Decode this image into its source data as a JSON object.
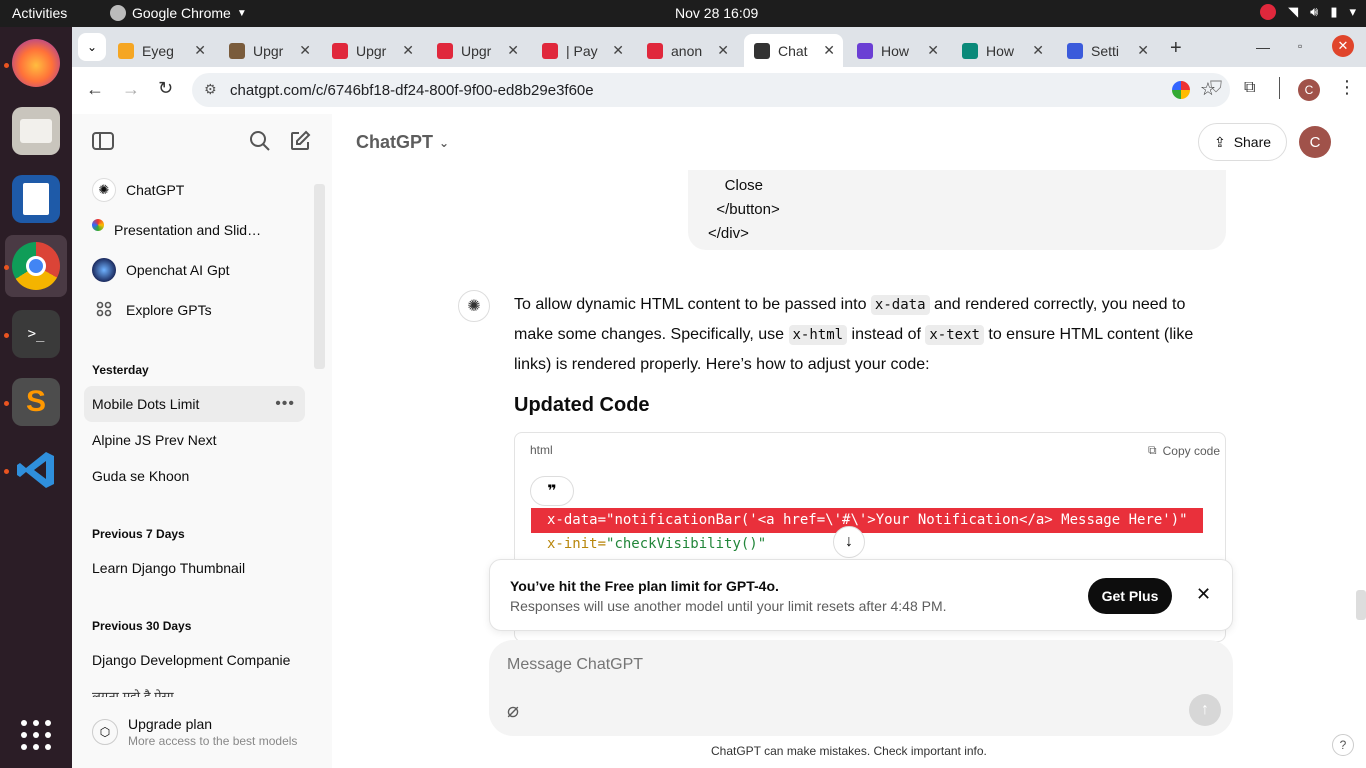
{
  "desktop": {
    "activities": "Activities",
    "app_name": "Google Chrome",
    "clock": "Nov 28  16:09"
  },
  "browser": {
    "tabs": [
      {
        "label": "Eyeg",
        "color": "#f5a623"
      },
      {
        "label": "Upgr",
        "color": "#7a5c3c"
      },
      {
        "label": "Upgr",
        "color": "#e0283c"
      },
      {
        "label": "Upgr",
        "color": "#e0283c"
      },
      {
        "label": "| Pay",
        "color": "#e0283c"
      },
      {
        "label": "anon",
        "color": "#e0283c"
      },
      {
        "label": "Chat",
        "color": "#333333"
      },
      {
        "label": "How",
        "color": "#6b3fd4"
      },
      {
        "label": "How",
        "color": "#0b8a7a"
      },
      {
        "label": "Setti",
        "color": "#3b5bdb"
      }
    ],
    "url": "chatgpt.com/c/6746bf18-df24-800f-9f00-ed8b29e3f60e",
    "profile_initial": "C"
  },
  "sidebar": {
    "pinned": [
      {
        "label": "ChatGPT"
      },
      {
        "label": "Presentation and Slid…"
      },
      {
        "label": "Openchat AI Gpt"
      },
      {
        "label": "Explore GPTs"
      }
    ],
    "sections": [
      {
        "title": "Yesterday",
        "items": [
          "Mobile Dots Limit",
          "Alpine JS Prev Next",
          "Guda se Khoon"
        ]
      },
      {
        "title": "Previous 7 Days",
        "items": [
          "Learn Django Thumbnail"
        ]
      },
      {
        "title": "Previous 30 Days",
        "items": [
          "Django Development Companie",
          "लगता मुझे है ऐसा"
        ]
      }
    ],
    "upgrade": {
      "title": "Upgrade plan",
      "subtitle": "More access to the best models"
    }
  },
  "header": {
    "model": "ChatGPT",
    "share": "Share",
    "avatar": "C"
  },
  "user_message": {
    "lines": [
      "    Close",
      "  </button>",
      "</div>"
    ]
  },
  "assistant": {
    "intro_1": "To allow dynamic HTML content to be passed into ",
    "code_1": "x-data",
    "intro_2": " and rendered correctly, you need to make some changes. Specifically, use ",
    "code_2": "x-html",
    "intro_3": " instead of ",
    "code_3": "x-text",
    "intro_4": " to ensure HTML content (like links) is rendered properly. Here’s how to adjust your code:",
    "heading": "Updated Code",
    "code_lang": "html",
    "copy_label": "Copy code",
    "code_line_1_attr": "x-data=",
    "code_line_1_val": "\"notificationBar('<a href=\\'#\\'>Your Notification</a> Message Here')\"",
    "code_line_2_attr": "x-init=",
    "code_line_2_val": "\"checkVisibility()\""
  },
  "limit_banner": {
    "title": "You’ve hit the Free plan limit for GPT-4o.",
    "subtitle": "Responses will use another model until your limit resets after 4:48 PM.",
    "button": "Get Plus"
  },
  "composer": {
    "placeholder": "Message ChatGPT",
    "disclaimer": "ChatGPT can make mistakes. Check important info."
  },
  "help": "?"
}
